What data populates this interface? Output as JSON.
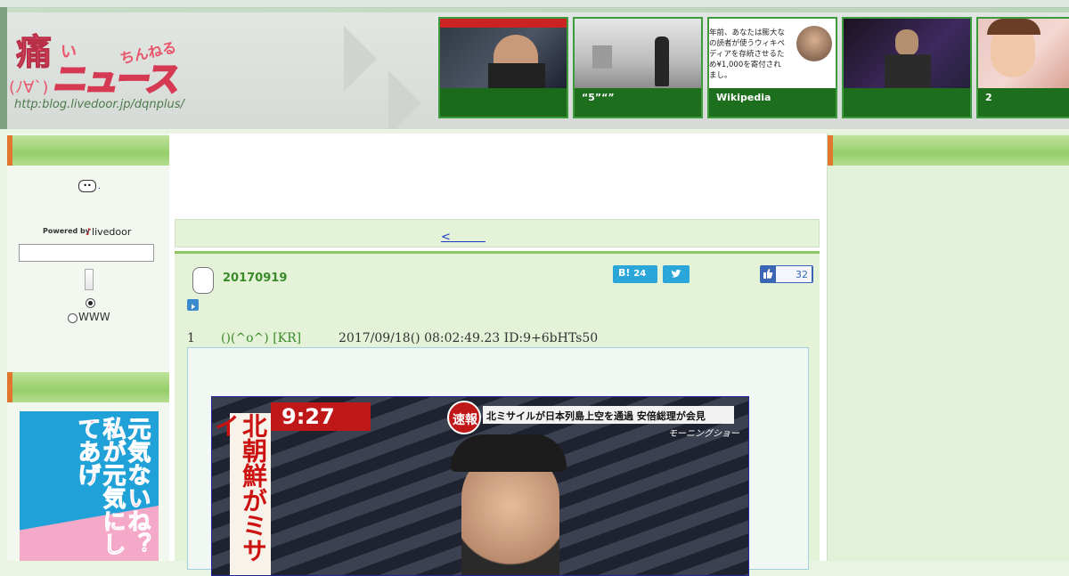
{
  "header": {
    "logo_kanji": "痛",
    "logo_small": "い",
    "logo_chan": "ちんねる",
    "logo_face": "(ﾉ∀`)",
    "logo_news": "ニュース",
    "logo_url": "http:blog.livedoor.jp/dqnplus/"
  },
  "thumbs": [
    {
      "caption": ""
    },
    {
      "caption": "“5”“”"
    },
    {
      "caption": "Wikipedia",
      "text": "年前、あなたは膨大なの読者が使うウィキペディアを存続させるため¥1,000を寄付されまし。"
    },
    {
      "caption": ""
    },
    {
      "caption": "2"
    }
  ],
  "sidebar": {
    "face_emoji": "😶",
    "powered_by": "Powered by",
    "livedoor": "livedoor",
    "search_value": "",
    "radio_www": "WWW",
    "banner": "元気ないね？私が元気にしてあげ"
  },
  "nav": {
    "prev_link": "<"
  },
  "article": {
    "title": "20170919",
    "hatebu_label": "B!",
    "hatebu_count": "24",
    "like_count": "32",
    "res_number": "1",
    "res_name": "()(^o^) [KR]",
    "res_date": "2017/09/18() 08:02:49.23 ID:9+6bHTs50",
    "tv_time": "9:27",
    "tv_flash": "速報",
    "tv_headline": "北ミサイルが日本列島上空を通過 安倍総理が会見",
    "tv_show": "モーニングショー",
    "tv_side": "北朝鮮がミサイ"
  },
  "colors": {
    "accent_green": "#3a8a2a",
    "link_blue": "#1d38c6",
    "band_orange": "#e2762e"
  }
}
